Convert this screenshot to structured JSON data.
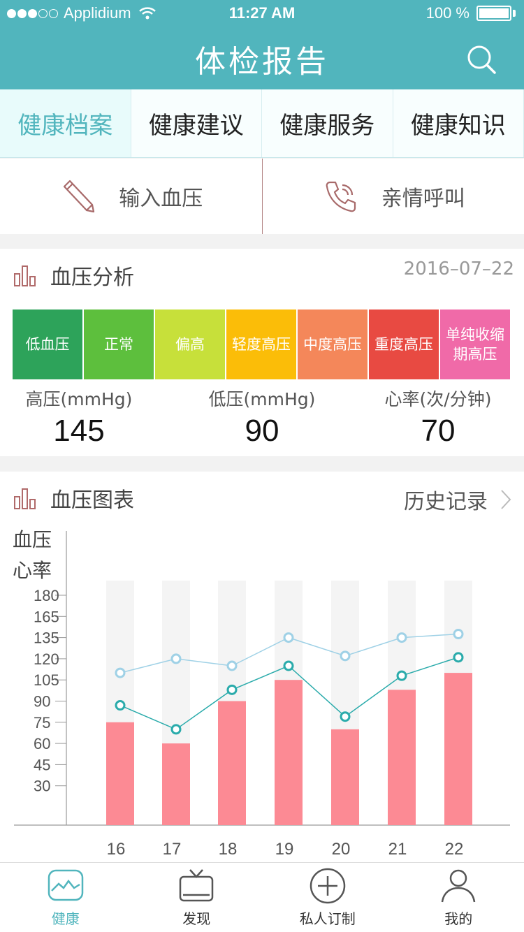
{
  "status_bar": {
    "carrier": "Applidium",
    "time": "11:27 AM",
    "battery": "100 %"
  },
  "header": {
    "title": "体检报告"
  },
  "tabs": [
    {
      "label": "健康档案",
      "active": true
    },
    {
      "label": "健康建议",
      "active": false
    },
    {
      "label": "健康服务",
      "active": false
    },
    {
      "label": "健康知识",
      "active": false
    }
  ],
  "actions": {
    "input_bp": "输入血压",
    "family_call": "亲情呼叫"
  },
  "analysis": {
    "title": "血压分析",
    "date": "2016–07–22",
    "levels": [
      {
        "label": "低血压",
        "color": "#2da35a"
      },
      {
        "label": "正常",
        "color": "#5dbf3d"
      },
      {
        "label": "偏高",
        "color": "#c7e03a"
      },
      {
        "label": "轻度高压",
        "color": "#fbbd08"
      },
      {
        "label": "中度高压",
        "color": "#f4875a"
      },
      {
        "label": "重度高压",
        "color": "#e84a42"
      },
      {
        "label": "单纯收缩期高压",
        "color": "#f06aa8"
      }
    ],
    "readings": [
      {
        "label": "高压(mmHg)",
        "value": "145"
      },
      {
        "label": "低压(mmHg)",
        "value": "90"
      },
      {
        "label": "心率(次/分钟)",
        "value": "70"
      }
    ]
  },
  "chart_section": {
    "title": "血压图表",
    "history": "历史记录"
  },
  "chart_data": {
    "type": "bar",
    "ylabel_lines": [
      "血压",
      "心率"
    ],
    "yticks": [
      180,
      165,
      135,
      120,
      105,
      90,
      75,
      60,
      45,
      30
    ],
    "ylim": [
      0,
      180
    ],
    "categories": [
      "16",
      "17",
      "18",
      "19",
      "20",
      "21",
      "22"
    ],
    "series": [
      {
        "kind": "bar",
        "values": [
          75,
          60,
          90,
          105,
          70,
          98,
          110
        ],
        "color": "#fc8a94"
      },
      {
        "kind": "line",
        "values": [
          110,
          120,
          115,
          135,
          122,
          135,
          140
        ],
        "color": "#9fd1e6"
      },
      {
        "kind": "line",
        "values": [
          87,
          70,
          98,
          115,
          79,
          108,
          121
        ],
        "color": "#2aabab"
      }
    ]
  },
  "bottom_nav": [
    {
      "label": "健康",
      "icon": "health-icon",
      "active": true
    },
    {
      "label": "发现",
      "icon": "tv-icon",
      "active": false
    },
    {
      "label": "私人订制",
      "icon": "plus-circle-icon",
      "active": false
    },
    {
      "label": "我的",
      "icon": "user-icon",
      "active": false
    }
  ]
}
